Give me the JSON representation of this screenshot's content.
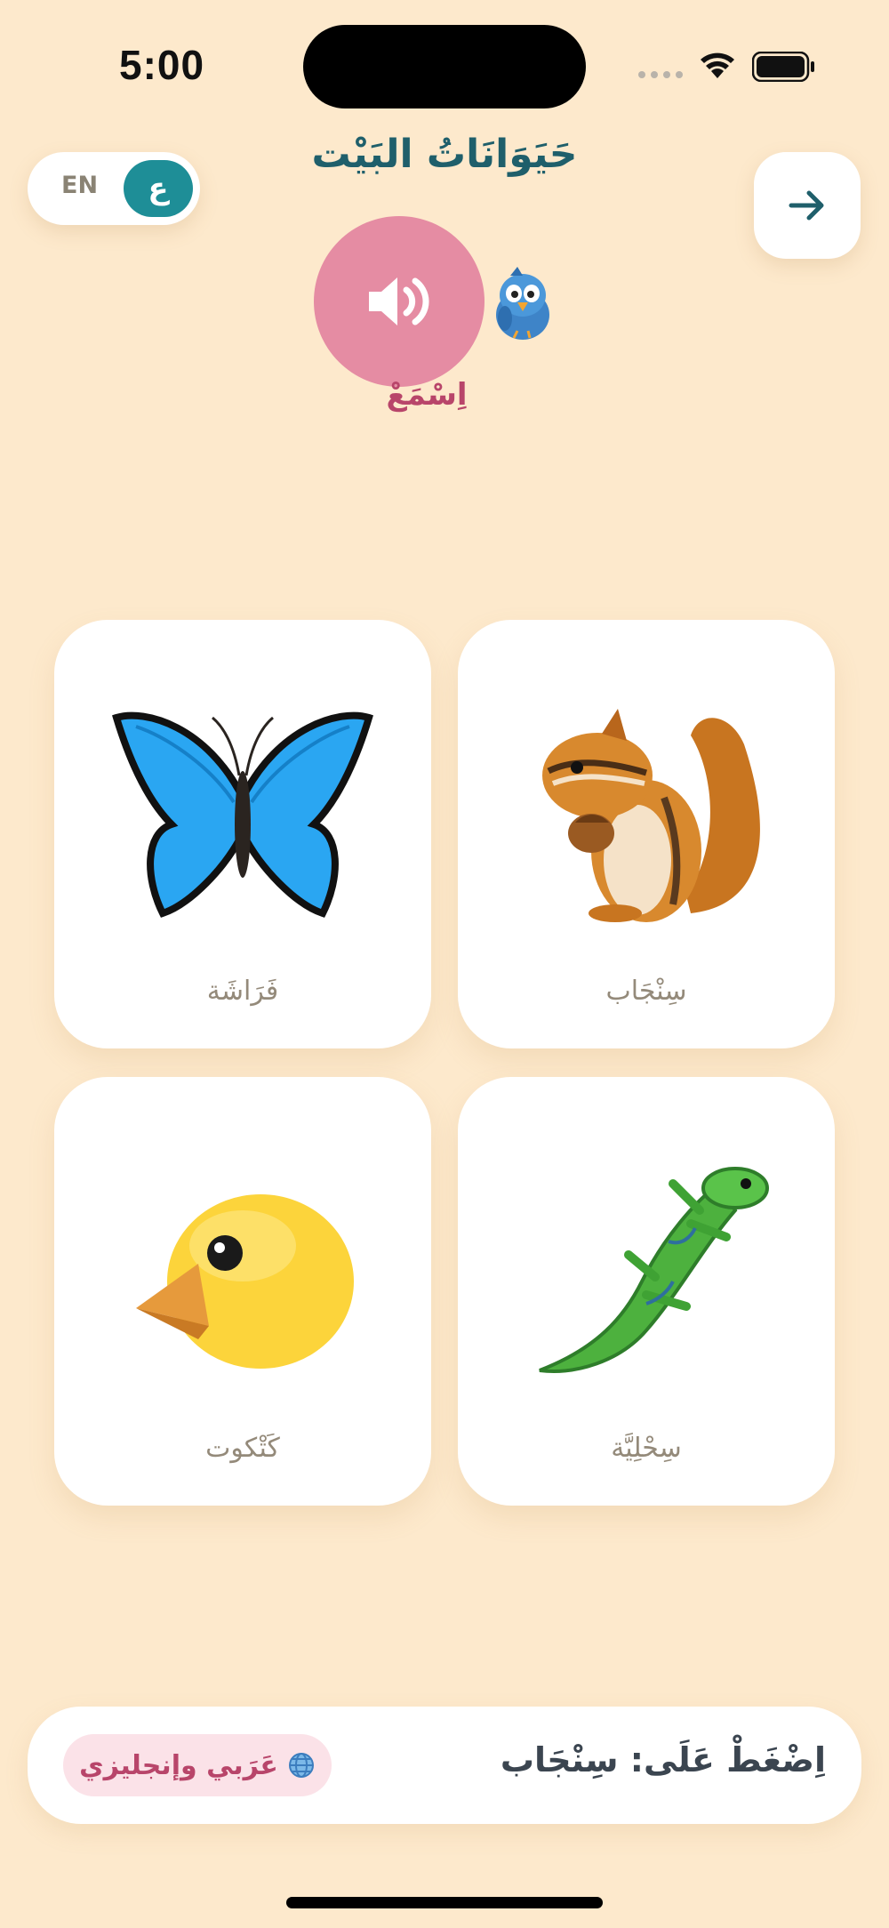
{
  "status_bar": {
    "time": "5:00",
    "icons": [
      "cellular-icon",
      "wifi-icon",
      "battery-icon"
    ]
  },
  "header": {
    "title": "حَيَوَانَاتُ البَيْت",
    "lang_toggle": {
      "inactive_label": "EN",
      "active_label": "ع"
    },
    "next_icon": "arrow-right-icon"
  },
  "listen": {
    "label": "اِسْمَعْ",
    "icon": "speaker-icon",
    "mascot_icon": "bird-mascot-icon"
  },
  "cards": [
    {
      "id": "butterfly",
      "label": "فَرَاشَة",
      "icon": "butterfly-icon"
    },
    {
      "id": "squirrel",
      "label": "سِنْجَاب",
      "icon": "chipmunk-icon"
    },
    {
      "id": "chick",
      "label": "كَتْكوت",
      "icon": "chick-icon"
    },
    {
      "id": "lizard",
      "label": "سِحْلِيَّة",
      "icon": "lizard-icon"
    }
  ],
  "prompt": {
    "text": "اِضْغَطْ عَلَى: سِنْجَاب",
    "mode_chip_label": "عَرَبي وإنجليزي",
    "mode_chip_icon": "globe-icon"
  },
  "colors": {
    "background": "#FDE9CC",
    "accent_teal": "#1E8E97",
    "title_teal": "#1F5F6B",
    "listen_pink": "#E58CA3",
    "label_rose": "#B8456A"
  }
}
